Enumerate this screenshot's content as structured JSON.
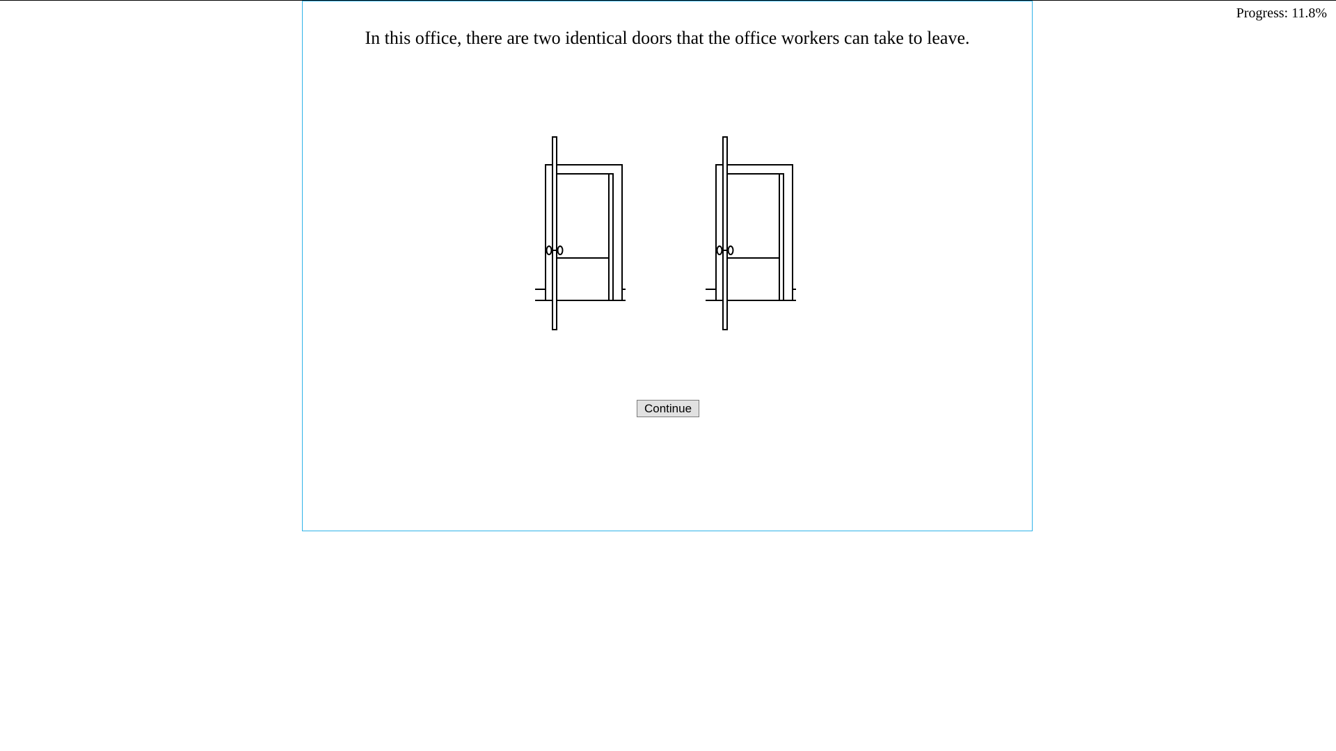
{
  "progress": {
    "label": "Progress: 11.8%",
    "value": 0.118
  },
  "stage": {
    "prompt": "In this office, there are two identical doors that the office workers can take to leave.",
    "continue_label": "Continue"
  },
  "doors": [
    {
      "name": "door-left",
      "icon": "open-door-icon"
    },
    {
      "name": "door-right",
      "icon": "open-door-icon"
    }
  ],
  "colors": {
    "stage_border": "#2eb2e8",
    "button_bg": "#e1e1e1",
    "button_border": "#7a7a7a"
  }
}
